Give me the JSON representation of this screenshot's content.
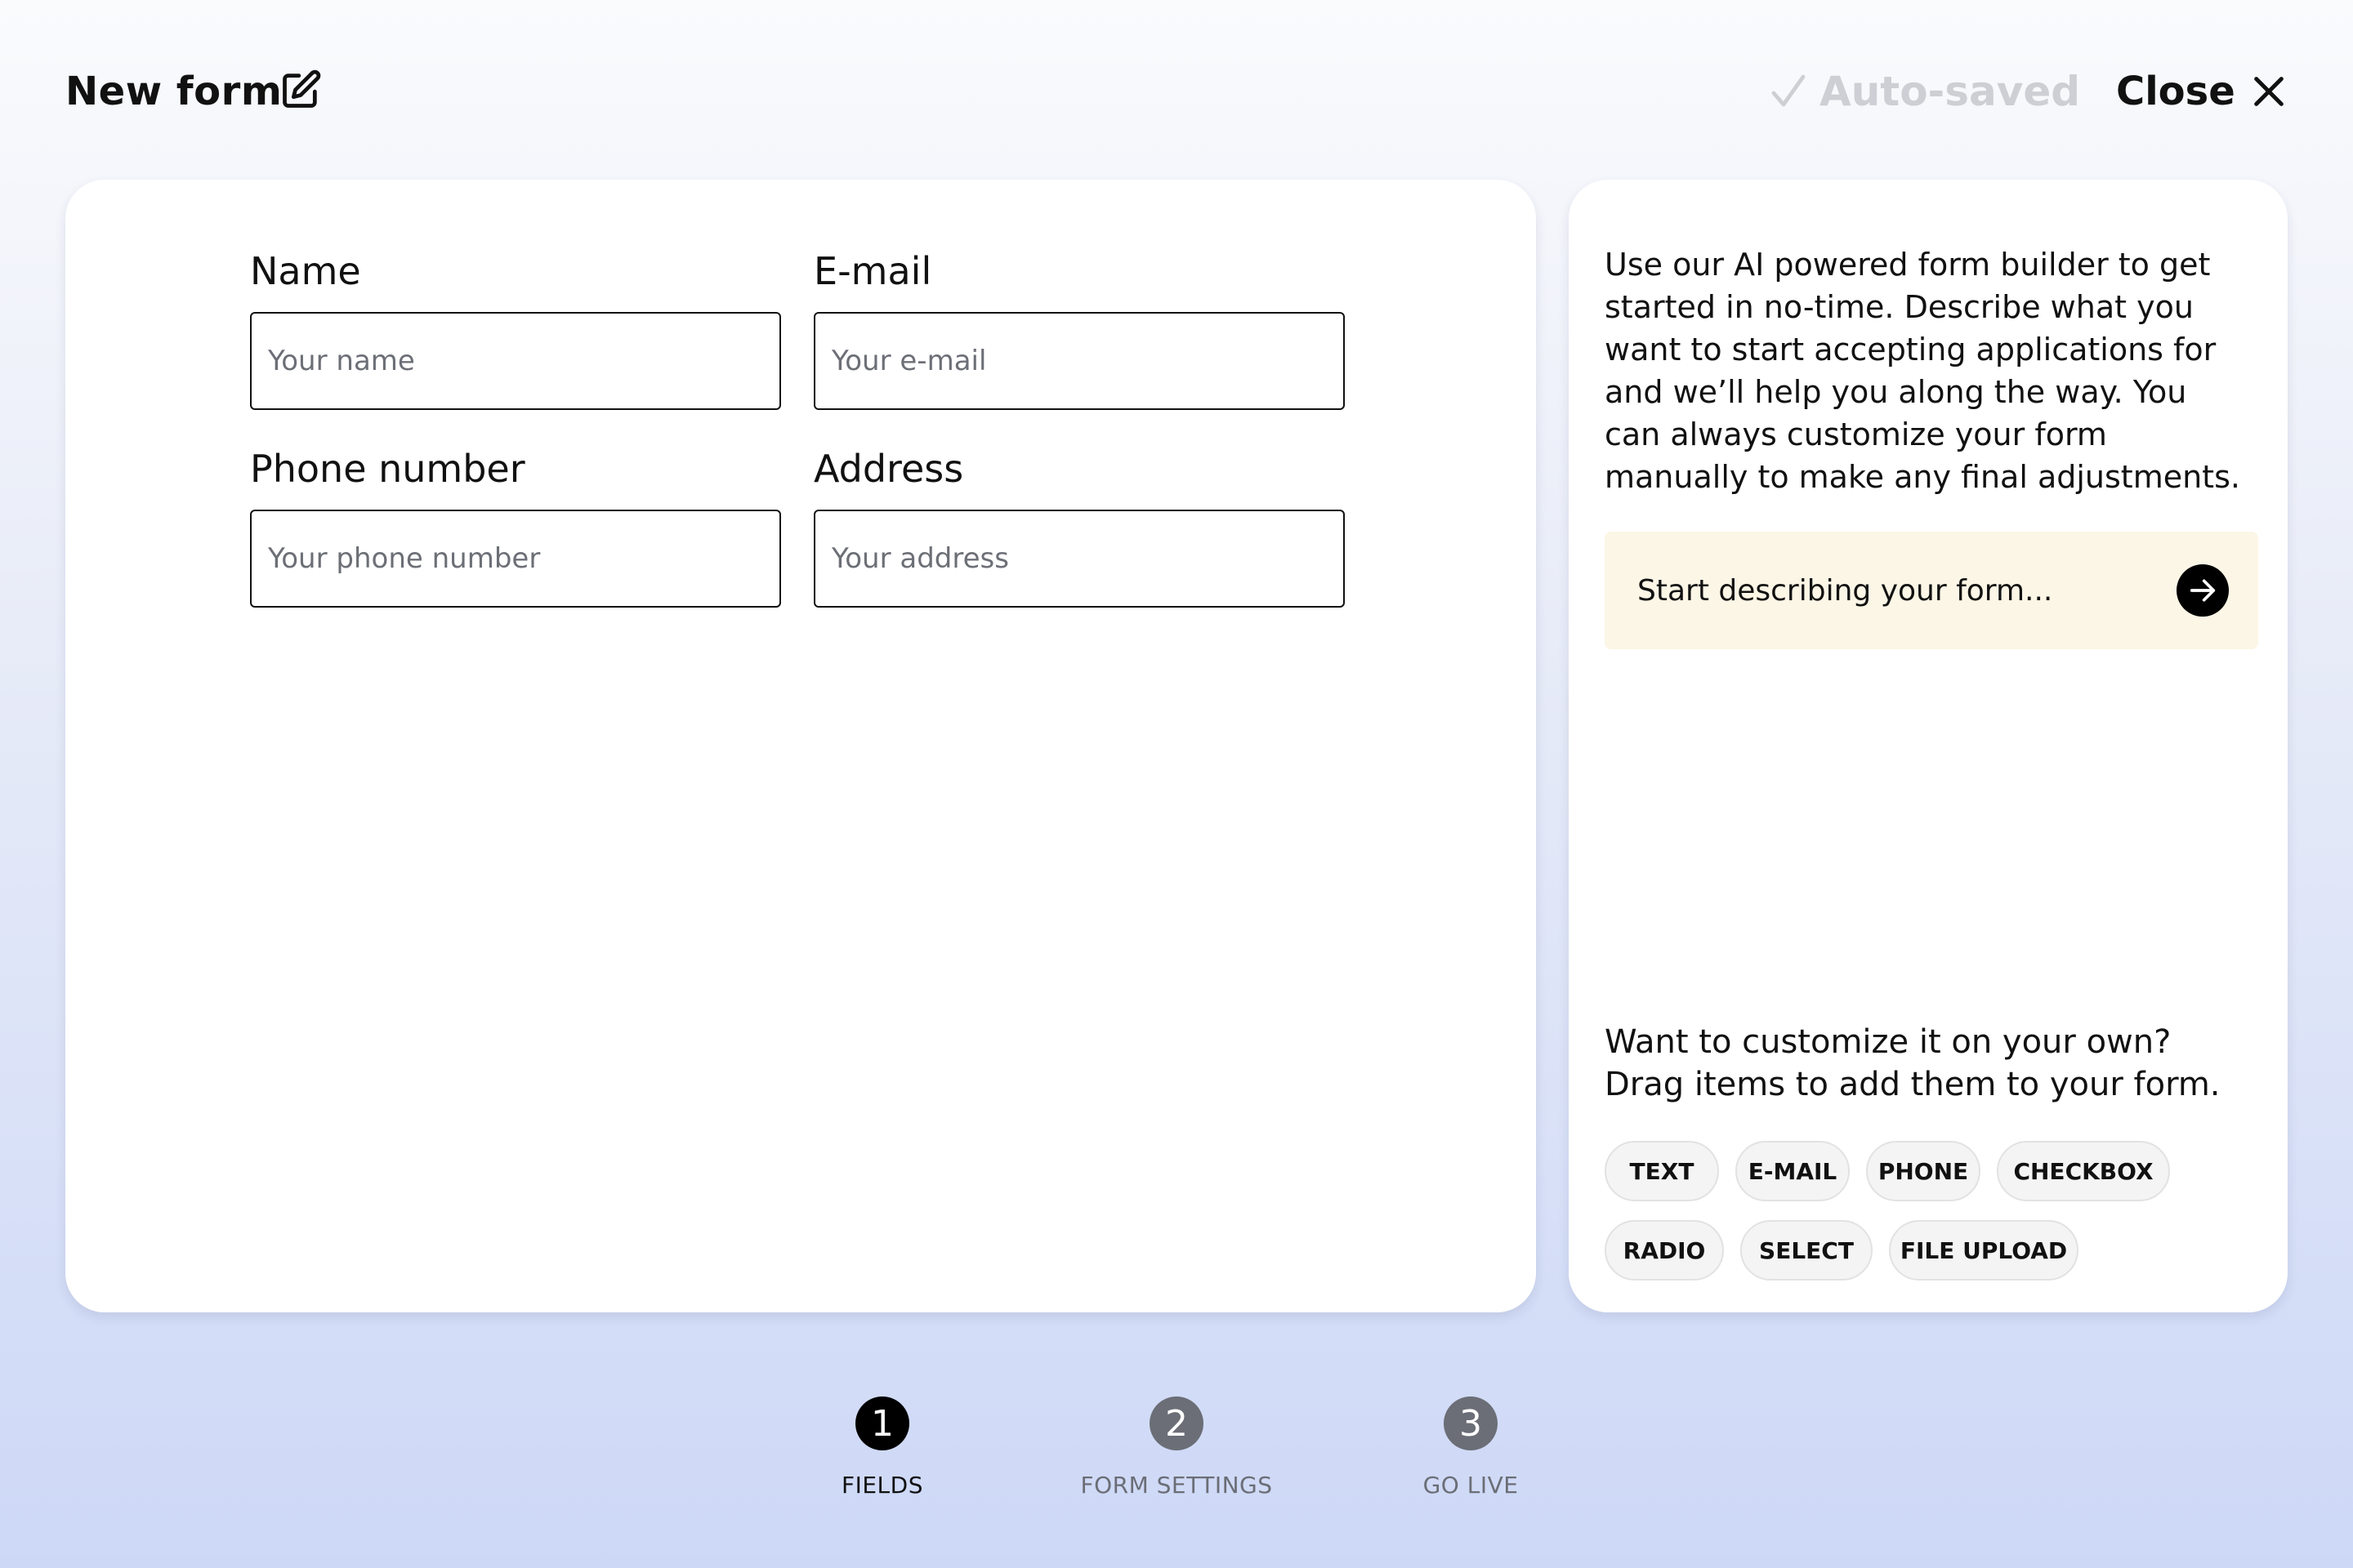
{
  "header": {
    "title": "New form",
    "autosaved_label": "Auto-saved",
    "close_label": "Close"
  },
  "form": {
    "fields": [
      {
        "label": "Name",
        "placeholder": "Your name"
      },
      {
        "label": "E-mail",
        "placeholder": "Your e-mail"
      },
      {
        "label": "Phone number",
        "placeholder": "Your phone number"
      },
      {
        "label": "Address",
        "placeholder": "Your address"
      }
    ]
  },
  "ai_panel": {
    "description": "Use our AI powered form builder to get started in no-time. Describe what you want to start accepting applications for and we’ll help you along the way. You can always customize your form manually to make any final adjustments.",
    "prompt_placeholder": "Start describing your form...",
    "drag_line1": "Want to customize it on your own?",
    "drag_line2": "Drag items to add them to your form.",
    "chips": [
      "TEXT",
      "E-MAIL",
      "PHONE",
      "CHECKBOX",
      "RADIO",
      "SELECT",
      "FILE UPLOAD"
    ]
  },
  "stepper": {
    "steps": [
      {
        "number": "1",
        "label": "FIELDS",
        "active": true
      },
      {
        "number": "2",
        "label": "FORM SETTINGS",
        "active": false
      },
      {
        "number": "3",
        "label": "GO LIVE",
        "active": false
      }
    ]
  },
  "colors": {
    "active_step": "#000000",
    "inactive_step": "#6b6e76",
    "prompt_bg": "#fcf6e6",
    "autosaved": "#cdcfd4"
  }
}
